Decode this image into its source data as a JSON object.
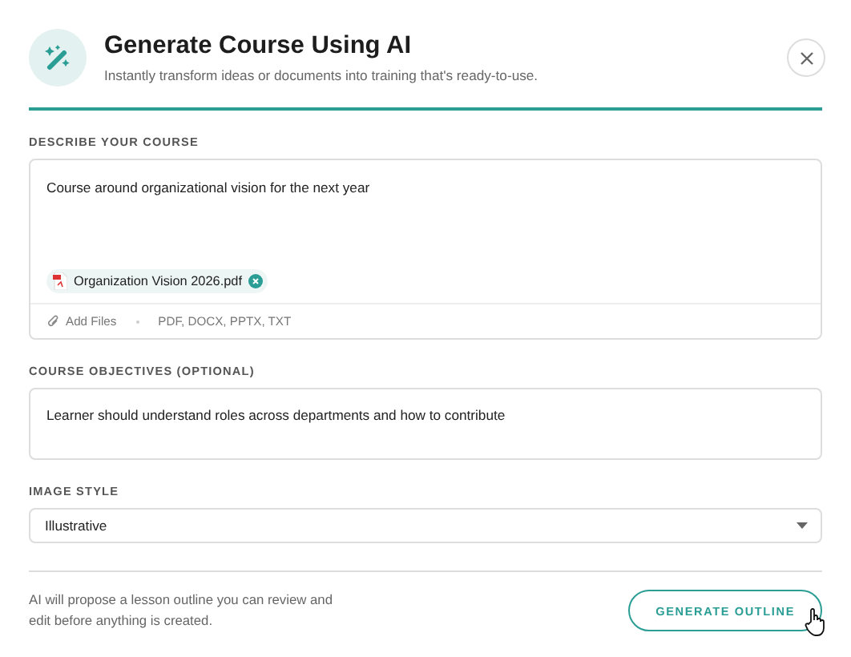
{
  "header": {
    "title": "Generate Course Using AI",
    "subtitle": "Instantly transform ideas or documents into training that's ready-to-use."
  },
  "describe": {
    "label": "DESCRIBE YOUR COURSE",
    "value": "Course around organizational vision for the next year",
    "attachments": [
      {
        "name": "Organization Vision 2026.pdf"
      }
    ],
    "add_files": "Add Files",
    "formats": "PDF, DOCX, PPTX, TXT"
  },
  "objectives": {
    "label": "COURSE OBJECTIVES (OPTIONAL)",
    "value": "Learner should understand roles across departments and how to contribute"
  },
  "image_style": {
    "label": "IMAGE STYLE",
    "value": "Illustrative"
  },
  "footer": {
    "note": "AI will propose a lesson outline you can review and edit before anything is created.",
    "button": "GENERATE OUTLINE"
  }
}
